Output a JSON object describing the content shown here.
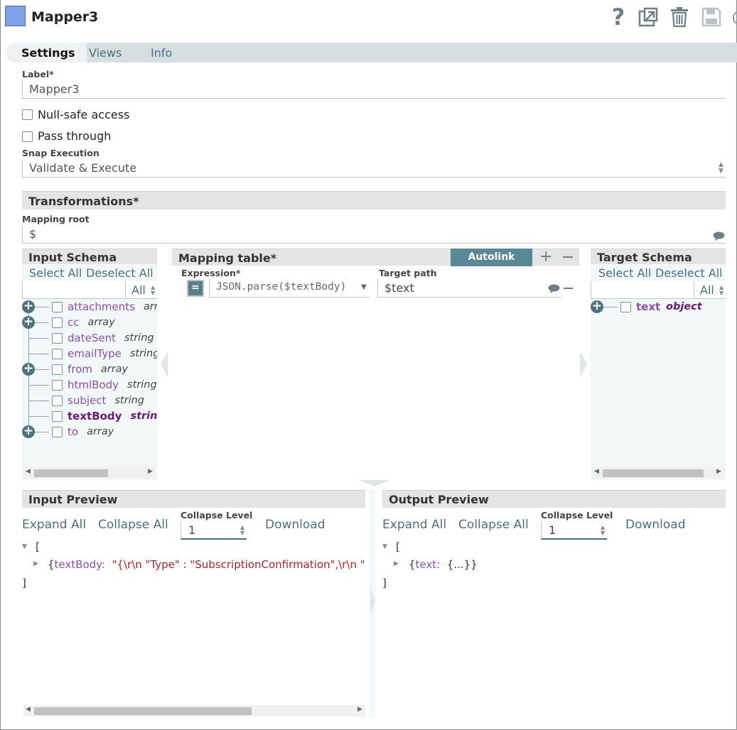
{
  "header": {
    "title": "Mapper3",
    "icons": [
      "help-icon",
      "export-icon",
      "delete-icon",
      "save-icon"
    ]
  },
  "tabs": [
    "Settings",
    "Views",
    "Info"
  ],
  "form": {
    "label_label": "Label*",
    "label_value": "Mapper3",
    "null_safe_label": "Null-safe access",
    "pass_through_label": "Pass through",
    "snap_execution_label": "Snap Execution",
    "snap_execution_value": "Validate & Execute"
  },
  "transformations": {
    "title": "Transformations*",
    "mapping_root_label": "Mapping root",
    "mapping_root_value": "$"
  },
  "input_schema": {
    "title": "Input Schema",
    "select_all": "Select All",
    "deselect_all": "Deselect All",
    "filter": "All",
    "fields": [
      {
        "name": "attachments",
        "type": "arra",
        "expandable": true,
        "highlight": false
      },
      {
        "name": "cc",
        "type": "array",
        "expandable": true,
        "highlight": false
      },
      {
        "name": "dateSent",
        "type": "string",
        "expandable": false,
        "highlight": false
      },
      {
        "name": "emailType",
        "type": "string",
        "expandable": false,
        "highlight": false
      },
      {
        "name": "from",
        "type": "array",
        "expandable": true,
        "highlight": false
      },
      {
        "name": "htmlBody",
        "type": "string",
        "expandable": false,
        "highlight": false
      },
      {
        "name": "subject",
        "type": "string",
        "expandable": false,
        "highlight": false
      },
      {
        "name": "textBody",
        "type": "string",
        "expandable": false,
        "highlight": true
      },
      {
        "name": "to",
        "type": "array",
        "expandable": true,
        "highlight": false
      }
    ]
  },
  "mapping_table": {
    "title": "Mapping table*",
    "autolink": "Autolink",
    "expression_label": "Expression*",
    "target_path_label": "Target path",
    "rows": [
      {
        "expression": "JSON.parse($textBody)",
        "target": "$text"
      }
    ]
  },
  "target_schema": {
    "title": "Target Schema",
    "select_all": "Select All",
    "deselect_all": "Deselect All",
    "filter": "All",
    "fields": [
      {
        "name": "text",
        "type": "object"
      }
    ]
  },
  "input_preview": {
    "title": "Input Preview",
    "expand_all": "Expand All",
    "collapse_all": "Collapse All",
    "collapse_level_label": "Collapse Level",
    "collapse_level": "1",
    "download": "Download",
    "open_bracket": "[",
    "row_key": "textBody:",
    "row_value": "\"{\\r\\n \"Type\" : \"SubscriptionConfirmation\",\\r\\n \"M",
    "close_bracket": "]"
  },
  "output_preview": {
    "title": "Output Preview",
    "expand_all": "Expand All",
    "collapse_all": "Collapse All",
    "collapse_level_label": "Collapse Level",
    "collapse_level": "1",
    "download": "Download",
    "open_bracket": "[",
    "row_key": "text:",
    "row_value": "{...}}",
    "close_bracket": "]"
  }
}
